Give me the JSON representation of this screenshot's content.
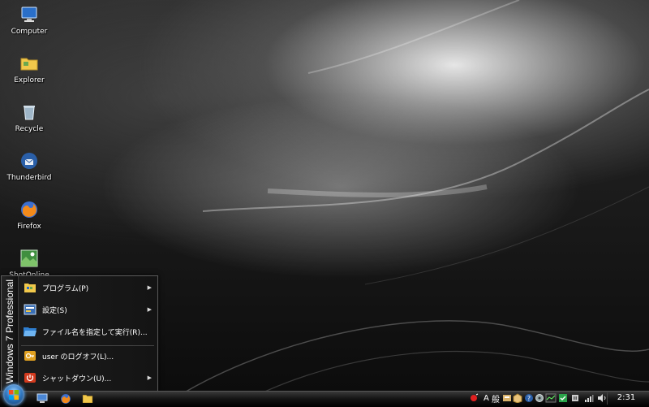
{
  "desktop": {
    "icons": [
      {
        "label": "Computer",
        "icon": "computer-icon"
      },
      {
        "label": "Explorer",
        "icon": "folder-icon"
      },
      {
        "label": "Recycle",
        "icon": "recycle-bin-icon"
      },
      {
        "label": "Thunderbird",
        "icon": "thunderbird-icon"
      },
      {
        "label": "Firefox",
        "icon": "firefox-icon"
      },
      {
        "label": "ShotOnline",
        "icon": "shotonline-icon"
      }
    ]
  },
  "start_menu": {
    "side_title": "Windows 7 Professional",
    "items": [
      {
        "label": "プログラム(P)",
        "icon": "programs-icon"
      },
      {
        "label": "設定(S)",
        "icon": "settings-icon"
      },
      {
        "label": "ファイル名を指定して実行(R)...",
        "icon": "run-icon"
      },
      {
        "label": "user のログオフ(L)...",
        "icon": "logoff-key-icon"
      },
      {
        "label": "シャットダウン(U)...",
        "icon": "shutdown-icon"
      }
    ]
  },
  "taskbar": {
    "ime_mode": "A",
    "ime_label": "般",
    "clock": "2:31"
  },
  "colors": {
    "accent": "#2f78c2",
    "shutdown": "#d23a1e",
    "key": "#e0a020"
  }
}
